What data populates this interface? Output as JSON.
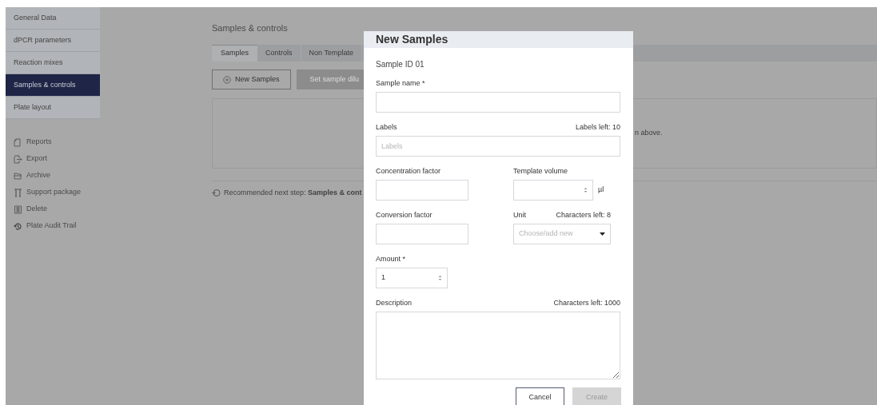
{
  "sidebar": {
    "nav": [
      {
        "label": "General Data",
        "selected": false
      },
      {
        "label": "dPCR parameters",
        "selected": false
      },
      {
        "label": "Reaction mixes",
        "selected": false
      },
      {
        "label": "Samples & controls",
        "selected": true
      },
      {
        "label": "Plate layout",
        "selected": false
      }
    ],
    "actions": [
      "Reports",
      "Export",
      "Archive",
      "Support package",
      "Delete",
      "Plate Audit Trail"
    ]
  },
  "main": {
    "title": "Samples & controls",
    "tabs": [
      {
        "label": "Samples",
        "selected": true
      },
      {
        "label": "Controls",
        "selected": false
      },
      {
        "label": "Non Template",
        "selected": false
      }
    ],
    "buttons": [
      {
        "label": "New Samples",
        "disabled": false
      },
      {
        "label": "Set sample dilu",
        "disabled": true
      }
    ],
    "panel_text": "n above.",
    "next_step": {
      "label": "Recommended next step:",
      "link": "Samples & cont"
    }
  },
  "dialog": {
    "title": "New Samples",
    "sample_id": "Sample ID 01",
    "rows": [
      [
        {
          "kind": "text",
          "label": "Sample name *"
        }
      ],
      [
        {
          "kind": "text",
          "label": "Labels",
          "counter": "Labels left: 10",
          "placeholder": "Labels"
        }
      ],
      [
        {
          "kind": "text",
          "label": "Concentration factor"
        },
        {
          "kind": "number",
          "label": "Template volume",
          "unit": "µl"
        }
      ],
      [
        {
          "kind": "text",
          "label": "Conversion factor"
        },
        {
          "kind": "select",
          "label": "Unit",
          "counter": "Characters left: 8",
          "placeholder": "Choose/add new"
        }
      ],
      [
        {
          "kind": "number",
          "label": "Amount *",
          "value": "1"
        }
      ],
      [
        {
          "kind": "textarea",
          "label": "Description",
          "counter": "Characters left: 1000"
        }
      ]
    ],
    "buttons": [
      {
        "label": "Cancel",
        "disabled": false
      },
      {
        "label": "Create",
        "disabled": true
      }
    ]
  }
}
